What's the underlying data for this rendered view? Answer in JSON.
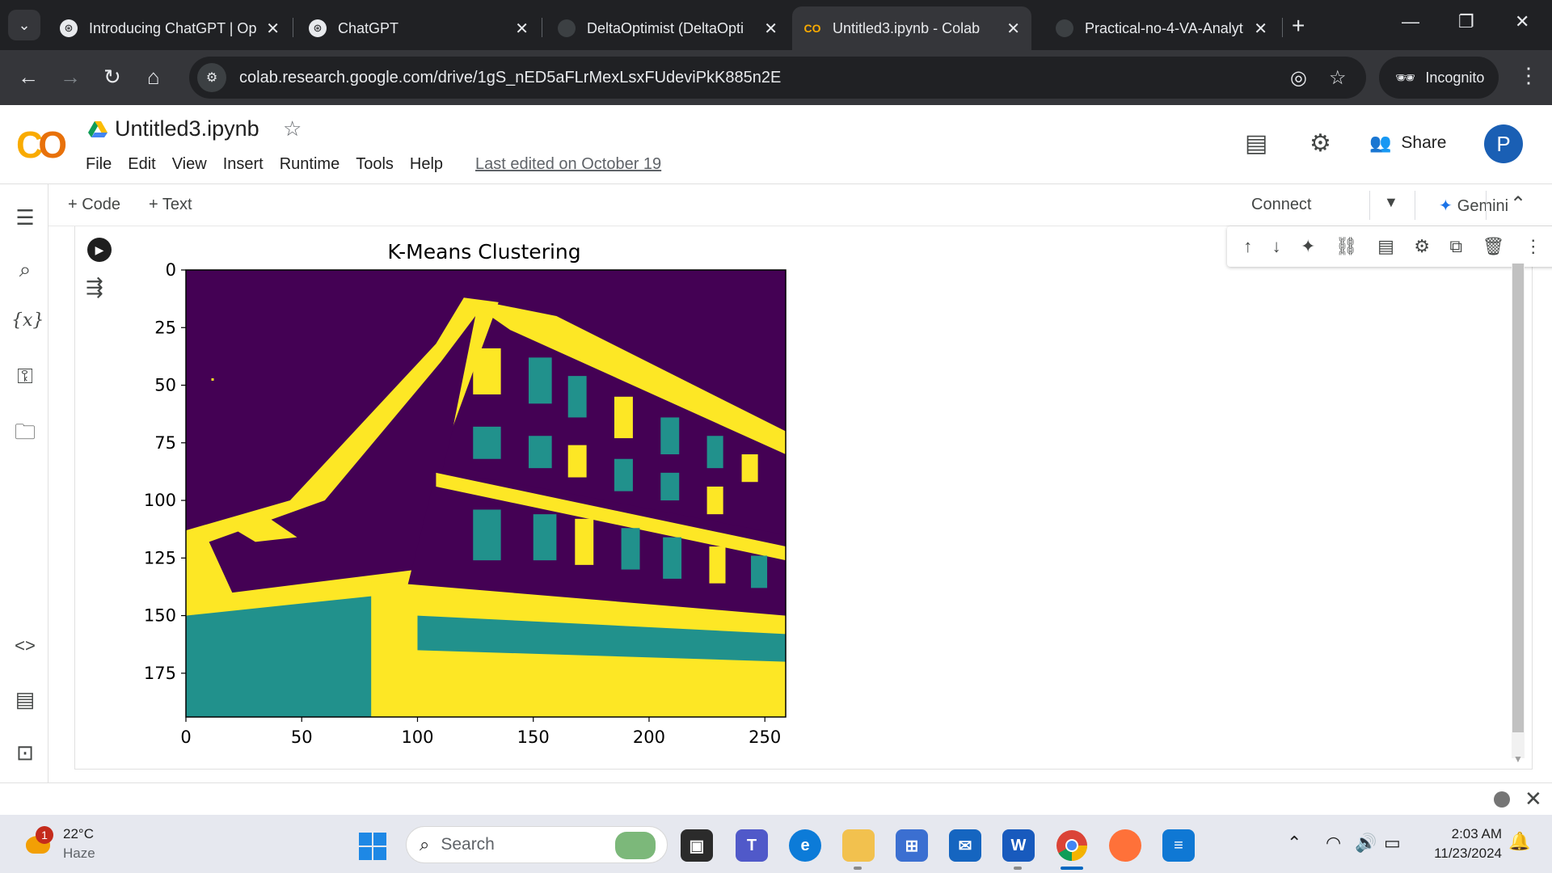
{
  "browser": {
    "tabs": [
      {
        "title": "Introducing ChatGPT | Op",
        "favicon": "openai-icon"
      },
      {
        "title": "ChatGPT",
        "favicon": "openai-icon"
      },
      {
        "title": "DeltaOptimist (DeltaOpti",
        "favicon": "github-icon"
      },
      {
        "title": "Untitled3.ipynb - Colab",
        "favicon": "colab-icon",
        "active": true
      },
      {
        "title": "Practical-no-4-VA-Analyt",
        "favicon": "github-icon"
      }
    ],
    "url": "colab.research.google.com/drive/1gS_nED5aFLrMexLsxFUdeviPkK885n2E",
    "incognito_label": "Incognito"
  },
  "colab": {
    "logo": "CO",
    "notebook_title": "Untitled3.ipynb",
    "menu": [
      "File",
      "Edit",
      "View",
      "Insert",
      "Runtime",
      "Tools",
      "Help"
    ],
    "last_edited": "Last edited on October 19",
    "share_label": "Share",
    "avatar_letter": "P",
    "toolbar": {
      "add_code": "+ Code",
      "add_text": "+ Text",
      "connect": "Connect",
      "gemini": "Gemini"
    }
  },
  "chart_data": {
    "type": "heatmap",
    "title": "K-Means Clustering",
    "description_note": "",
    "xlim": [
      0,
      259
    ],
    "ylim": [
      194,
      0
    ],
    "xticks": [
      0,
      50,
      100,
      150,
      200,
      250
    ],
    "yticks": [
      0,
      25,
      50,
      75,
      100,
      125,
      150,
      175
    ],
    "colormap": [
      "#440154",
      "#21918c",
      "#fde725"
    ],
    "clusters": 3
  },
  "taskbar": {
    "weather_temp": "22°C",
    "weather_desc": "Haze",
    "weather_badge": "1",
    "search_placeholder": "Search",
    "time": "2:03 AM",
    "date": "11/23/2024"
  },
  "colors": {
    "chrome_dark": "#202124",
    "chrome_mid": "#35363a",
    "colab_orange": "#f9ab00",
    "avatar_blue": "#1a5fb4"
  }
}
